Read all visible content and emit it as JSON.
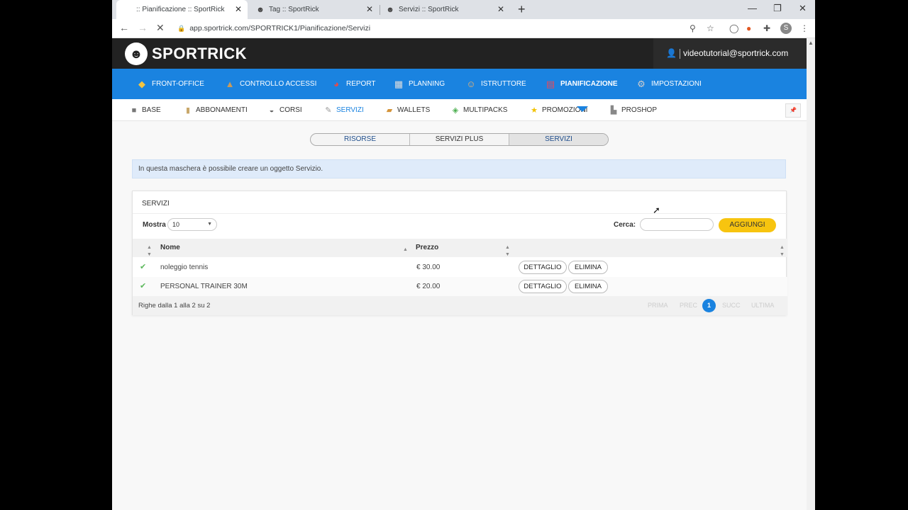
{
  "browser": {
    "tabs": [
      {
        "label": ":: Pianificazione :: SportRick",
        "icon": "page-icon"
      },
      {
        "label": "Tag :: SportRick",
        "icon": "sportrick-icon"
      },
      {
        "label": "Servizi :: SportRick",
        "icon": "sportrick-icon"
      }
    ],
    "new_tab": "+",
    "url": "app.sportrick.com/SPORTRICK1/Pianificazione/Servizi",
    "profile_initial": "S"
  },
  "header": {
    "logo_text": "SPORTRICK",
    "user_email": "videotutorial@sportrick.com"
  },
  "main_menu": [
    {
      "label": "FRONT-OFFICE"
    },
    {
      "label": "CONTROLLO ACCESSI"
    },
    {
      "label": "REPORT"
    },
    {
      "label": "PLANNING"
    },
    {
      "label": "ISTRUTTORE"
    },
    {
      "label": "PIANIFICAZIONE",
      "active": true
    },
    {
      "label": "IMPOSTAZIONI"
    }
  ],
  "sub_menu": [
    {
      "label": "BASE"
    },
    {
      "label": "ABBONAMENTI"
    },
    {
      "label": "CORSI"
    },
    {
      "label": "SERVIZI",
      "active": true
    },
    {
      "label": "WALLETS"
    },
    {
      "label": "MULTIPACKS"
    },
    {
      "label": "PROMOZIONI"
    },
    {
      "label": "PROSHOP"
    }
  ],
  "segments": [
    {
      "label": "RISORSE"
    },
    {
      "label": "SERVIZI PLUS"
    },
    {
      "label": "SERVIZI",
      "active": true
    }
  ],
  "info_text": "In questa maschera è possibile creare un oggetto Servizio.",
  "panel": {
    "title": "SERVIZI",
    "show_label": "Mostra",
    "show_value": "10",
    "search_label": "Cerca:",
    "search_value": "",
    "add_button": "AGGIUNGI",
    "columns": {
      "name": "Nome",
      "price": "Prezzo"
    },
    "rows": [
      {
        "name": "noleggio tennis",
        "price": "€ 30.00",
        "detail": "DETTAGLIO",
        "delete": "ELIMINA"
      },
      {
        "name": "PERSONAL TRAINER 30M",
        "price": "€ 20.00",
        "detail": "DETTAGLIO",
        "delete": "ELIMINA"
      }
    ],
    "footer_info": "Righe dalla 1 alla 2 su 2",
    "pager": {
      "first": "PRIMA",
      "prev": "PREC",
      "current": "1",
      "next": "SUCC",
      "last": "ULTIMA"
    }
  },
  "colors": {
    "menu_blue": "#1a83e0",
    "header_dark": "#222222",
    "add_yellow": "#f7c40f"
  }
}
